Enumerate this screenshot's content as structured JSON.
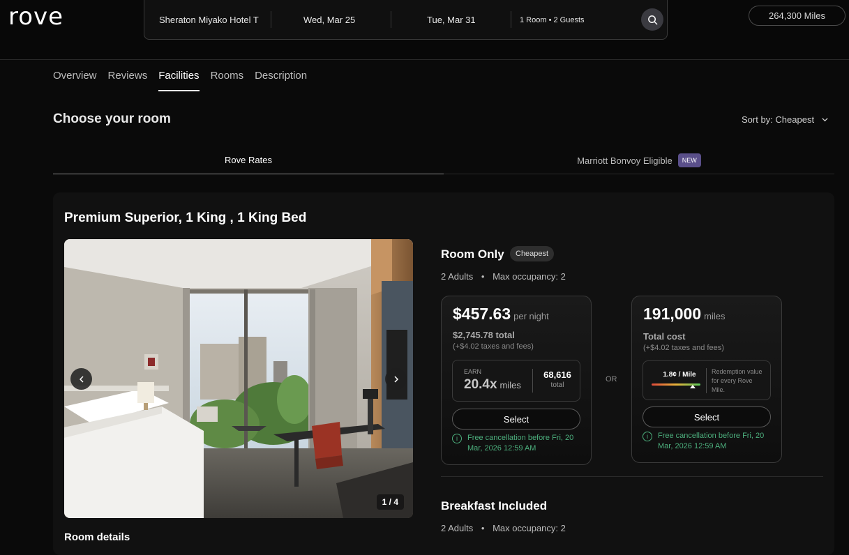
{
  "header": {
    "logo": "rove",
    "search": {
      "destination": "Sheraton Miyako Hotel T",
      "checkin": "Wed, Mar 25",
      "checkout": "Tue, Mar 31",
      "guests": "1 Room • 2 Guests"
    },
    "miles_balance": "264,300 Miles"
  },
  "tabs": [
    "Overview",
    "Reviews",
    "Facilities",
    "Rooms",
    "Description"
  ],
  "active_tab": "Facilities",
  "section": {
    "title": "Choose your room",
    "sort_label": "Sort by: Cheapest"
  },
  "rate_tabs": {
    "rove": "Rove Rates",
    "marriott": "Marriott Bonvoy Eligible",
    "new_badge": "NEW"
  },
  "room": {
    "title": "Premium Superior, 1 King , 1 King Bed",
    "photo_counter": "1 / 4",
    "details_label": "Room details",
    "options": [
      {
        "title": "Room Only",
        "badge": "Cheapest",
        "adults": "2 Adults",
        "occupancy": "Max occupancy: 2",
        "cash": {
          "price": "$457.63",
          "unit": "per night",
          "total": "$2,745.78 total",
          "taxes": "(+$4.02 taxes and fees)",
          "earn_label": "EARN",
          "earn_multiplier": "20.4x",
          "earn_unit": "miles",
          "earn_total": "68,616",
          "earn_total_label": "total",
          "select_label": "Select",
          "cancellation": "Free cancellation before Fri, 20 Mar, 2026 12:59 AM"
        },
        "or_label": "OR",
        "miles": {
          "price": "191,000",
          "unit": "miles",
          "total": "Total cost",
          "taxes": "(+$4.02 taxes and fees)",
          "redemption_rate": "1.8¢ / Mile",
          "redemption_text": "Redemption value for every Rove Mile.",
          "select_label": "Select",
          "cancellation": "Free cancellation before Fri, 20 Mar, 2026 12:59 AM"
        }
      },
      {
        "title": "Breakfast Included",
        "adults": "2 Adults",
        "occupancy": "Max occupancy: 2"
      }
    ]
  },
  "colors": {
    "background": "#0a0a0a",
    "card": "#111111",
    "accent_green": "#4caf7d",
    "new_badge": "#5a4f8a"
  }
}
